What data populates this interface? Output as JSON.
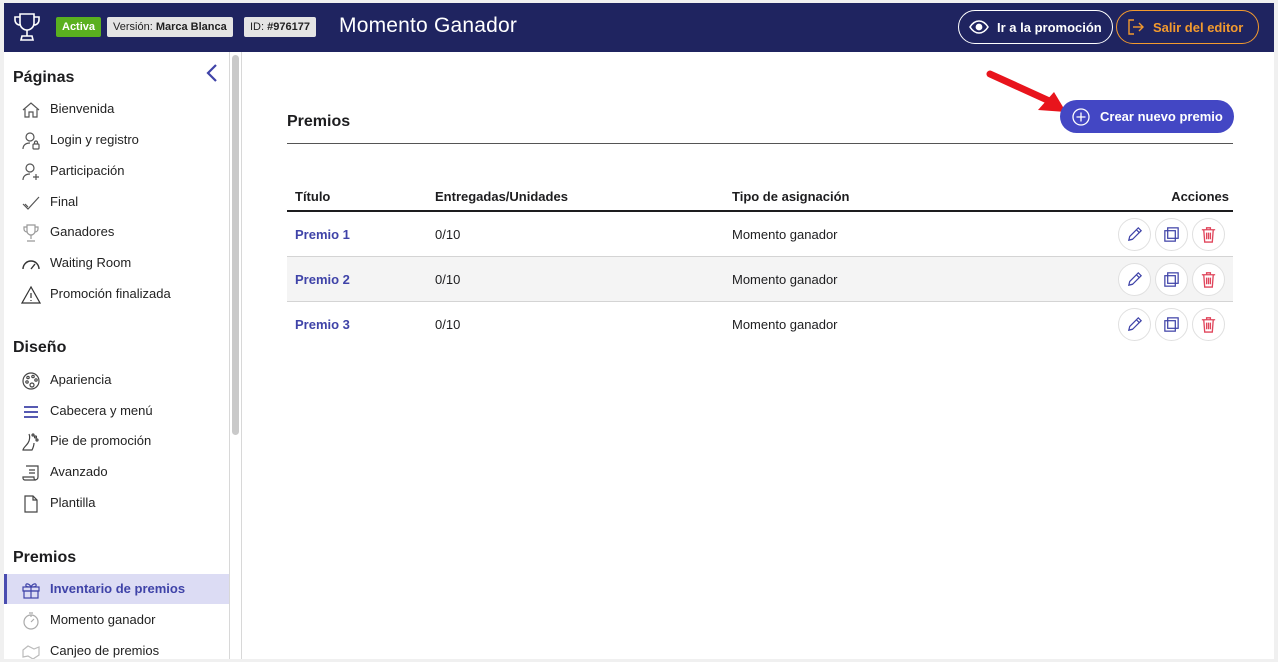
{
  "header": {
    "status_badge": "Activa",
    "version_prefix": "Versión:",
    "version_value": "Marca Blanca",
    "id_prefix": "ID:",
    "id_value": "#976177",
    "app_title": "Momento Ganador",
    "promo_button": "Ir a la promoción",
    "exit_button": "Salir del editor"
  },
  "sidebar": {
    "sections": [
      {
        "title": "Páginas",
        "items": [
          {
            "label": "Bienvenida",
            "icon": "home-icon"
          },
          {
            "label": "Login y registro",
            "icon": "user-lock-icon"
          },
          {
            "label": "Participación",
            "icon": "user-add-icon"
          },
          {
            "label": "Final",
            "icon": "check-icon"
          },
          {
            "label": "Ganadores",
            "icon": "trophy-icon"
          },
          {
            "label": "Waiting Room",
            "icon": "gauge-icon"
          },
          {
            "label": "Promoción finalizada",
            "icon": "warning-icon"
          }
        ]
      },
      {
        "title": "Diseño",
        "items": [
          {
            "label": "Apariencia",
            "icon": "palette-icon"
          },
          {
            "label": "Cabecera y menú",
            "icon": "menu-icon"
          },
          {
            "label": "Pie de promoción",
            "icon": "footer-icon"
          },
          {
            "label": "Avanzado",
            "icon": "scroll-icon"
          },
          {
            "label": "Plantilla",
            "icon": "file-icon"
          }
        ]
      },
      {
        "title": "Premios",
        "items": [
          {
            "label": "Inventario de premios",
            "icon": "gift-icon",
            "selected": true
          },
          {
            "label": "Momento ganador",
            "icon": "stopwatch-icon"
          },
          {
            "label": "Canjeo de premios",
            "icon": "exchange-icon"
          }
        ]
      }
    ]
  },
  "main": {
    "heading": "Premios",
    "create_button": "Crear nuevo premio",
    "columns": [
      "Título",
      "Entregadas/Unidades",
      "Tipo de asignación",
      "Acciones"
    ],
    "rows": [
      {
        "title": "Premio 1",
        "units": "0/10",
        "type": "Momento ganador"
      },
      {
        "title": "Premio 2",
        "units": "0/10",
        "type": "Momento ganador"
      },
      {
        "title": "Premio 3",
        "units": "0/10",
        "type": "Momento ganador"
      }
    ]
  },
  "colors": {
    "topbar": "#1f2460",
    "accent": "#4347c4",
    "active": "#5ab01f",
    "exit": "#f39a2e",
    "delete": "#e0455b",
    "arrow": "#e8141c"
  }
}
